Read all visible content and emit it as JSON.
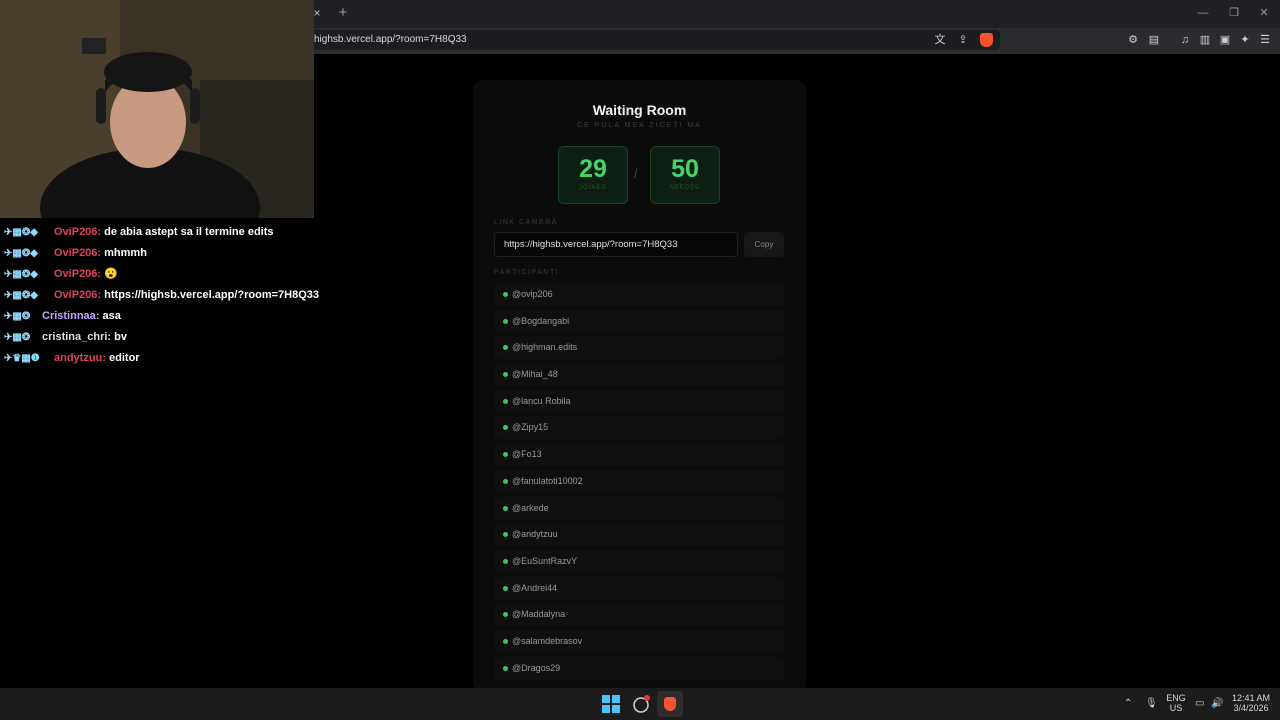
{
  "browser": {
    "url": "highsb.vercel.app/?room=7H8Q33",
    "tab_close_glyph": "×",
    "new_tab_glyph": "+"
  },
  "page": {
    "title": "Waiting Room",
    "subtitle": "CE PULA MEA ZICETI MA",
    "counter_joined": {
      "value": "29",
      "label": "JOINED"
    },
    "counter_needed": {
      "value": "50",
      "label": "NEEDED"
    },
    "separator": "/",
    "link_label": "LINK CAMERĂ",
    "link_value": "https://highsb.vercel.app/?room=7H8Q33",
    "copy_label": "Copy",
    "participants_label": "PARTICIPANȚI",
    "participants": [
      "@ovip206",
      "@Bogdangabi",
      "@highman.edits",
      "@Mihai_48",
      "@lancu Robila",
      "@Zipy15",
      "@Fo13",
      "@fanulatoti10002",
      "@arkede",
      "@andytzuu",
      "@EuSuntRazvY",
      "@Andrei44",
      "@Maddalyna",
      "@salamdebrasov",
      "@Dragos29"
    ]
  },
  "chat": {
    "messages": [
      {
        "user": "OviP206:",
        "text": "de abia astept sa il termine edits",
        "color": "#e0435c"
      },
      {
        "user": "OviP206:",
        "text": "mhmmh",
        "color": "#e0435c"
      },
      {
        "user": "OviP206:",
        "text": "😮",
        "color": "#e0435c"
      },
      {
        "user": "OviP206:",
        "text": "https://highsb.vercel.app/?room=7H8Q33",
        "color": "#e0435c"
      },
      {
        "user": "Cristinnaa:",
        "text": "asa",
        "color": "#c9a4ff"
      },
      {
        "user": "cristina_chri:",
        "text": "bv",
        "color": "#dedede"
      },
      {
        "user": "andytzuu:",
        "text": "editor",
        "color": "#e0435c"
      }
    ]
  },
  "taskbar": {
    "lang_top": "ENG",
    "lang_bottom": "US",
    "time": "12:41 AM",
    "date": "3/4/2026"
  }
}
